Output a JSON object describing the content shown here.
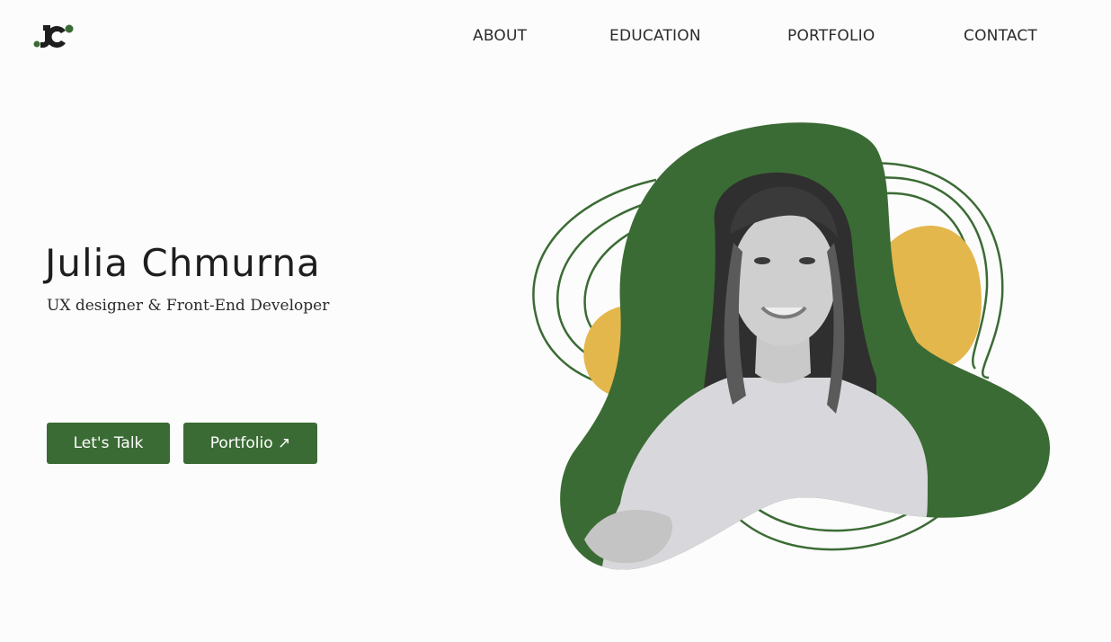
{
  "header": {
    "logo_text": "JC",
    "nav": [
      {
        "label": "ABOUT"
      },
      {
        "label": "EDUCATION"
      },
      {
        "label": "PORTFOLIO"
      },
      {
        "label": "CONTACT"
      }
    ]
  },
  "hero": {
    "name": "Julia Chmurna",
    "subtitle": "UX designer & Front-End Developer",
    "primary_button": "Let's Talk",
    "secondary_button": "Portfolio ↗"
  },
  "colors": {
    "accent_green": "#3b6b34",
    "accent_yellow": "#e4b74c",
    "text_dark": "#1e1e1e",
    "background": "#fcfcfc"
  }
}
